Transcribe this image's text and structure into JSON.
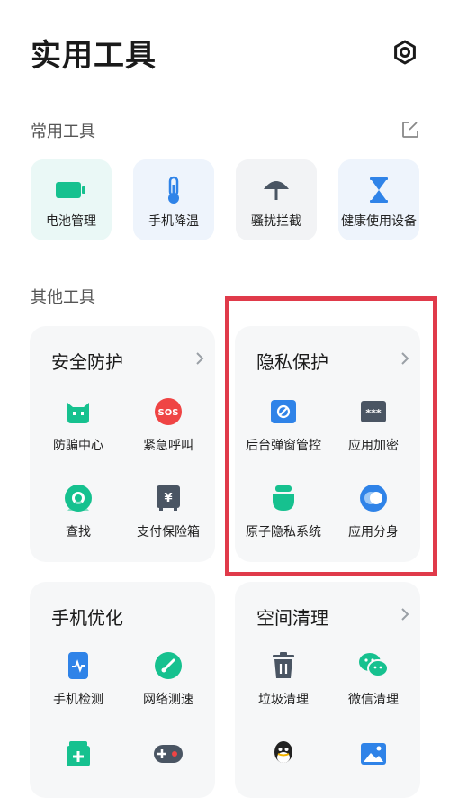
{
  "header": {
    "title": "实用工具",
    "settings_icon": "gear-icon"
  },
  "common_tools": {
    "title": "常用工具",
    "edit_icon": "edit-icon",
    "items": [
      {
        "label": "电池管理",
        "icon": "battery-icon",
        "bg": "#eaf8f6",
        "color": "#16c18f"
      },
      {
        "label": "手机降温",
        "icon": "thermometer-icon",
        "bg": "#eef4fc",
        "color": "#2f83e8"
      },
      {
        "label": "骚扰拦截",
        "icon": "umbrella-icon",
        "bg": "#f2f3f5",
        "color": "#4a5563"
      },
      {
        "label": "健康使用设备",
        "icon": "hourglass-icon",
        "bg": "#eef4fc",
        "color": "#2f83e8"
      }
    ]
  },
  "other_tools": {
    "title": "其他工具",
    "cards": [
      {
        "title": "安全防护",
        "items": [
          {
            "label": "防骗中心",
            "icon": "anti-fraud-icon",
            "color": "#16c18f"
          },
          {
            "label": "紧急呼叫",
            "icon": "sos-icon",
            "color": "#ef4444",
            "glyph": "SOS"
          },
          {
            "label": "查找",
            "icon": "find-device-icon",
            "color": "#16c18f"
          },
          {
            "label": "支付保险箱",
            "icon": "payment-safe-icon",
            "color": "#4a5563",
            "glyph": "¥"
          }
        ]
      },
      {
        "title": "隐私保护",
        "items": [
          {
            "label": "后台弹窗管控",
            "icon": "popup-block-icon",
            "color": "#2f83e8"
          },
          {
            "label": "应用加密",
            "icon": "app-lock-icon",
            "color": "#4a5563",
            "glyph": "***"
          },
          {
            "label": "原子隐私系统",
            "icon": "privacy-system-icon",
            "color": "#16c18f"
          },
          {
            "label": "应用分身",
            "icon": "app-clone-icon",
            "color": "#2f83e8"
          }
        ]
      },
      {
        "title": "手机优化",
        "items": [
          {
            "label": "手机检测",
            "icon": "phone-check-icon",
            "color": "#2f83e8"
          },
          {
            "label": "网络测速",
            "icon": "speed-test-icon",
            "color": "#16c18f"
          },
          {
            "label": "",
            "icon": "plus-box-icon",
            "color": "#16c18f"
          },
          {
            "label": "",
            "icon": "gamepad-icon",
            "color": "#4a5563"
          }
        ]
      },
      {
        "title": "空间清理",
        "items": [
          {
            "label": "垃圾清理",
            "icon": "trash-icon",
            "color": "#4a5563"
          },
          {
            "label": "微信清理",
            "icon": "wechat-icon",
            "color": "#16c18f"
          },
          {
            "label": "",
            "icon": "qq-icon",
            "color": "#222222"
          },
          {
            "label": "",
            "icon": "gallery-icon",
            "color": "#2f83e8"
          }
        ]
      }
    ]
  }
}
